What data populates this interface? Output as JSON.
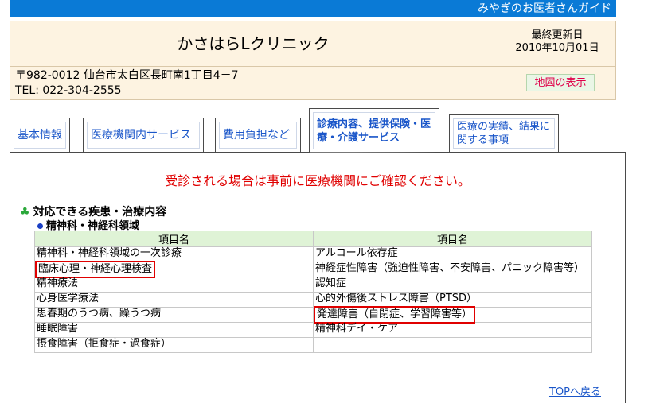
{
  "banner": "みやぎのお医者さんガイド",
  "clinic_name": "かさはらLクリニック",
  "updated": {
    "label": "最終更新日",
    "date": "2010年10月01日"
  },
  "address": {
    "line1": "〒982-0012 仙台市太白区長町南1丁目4－7",
    "line2": "TEL: 022-304-2555"
  },
  "map_button": "地図の表示",
  "tabs": [
    {
      "label": "基本情報"
    },
    {
      "label": "医療機関内サービス"
    },
    {
      "label": "費用負担など"
    },
    {
      "label": "診療内容、提供保険・医療・介護サービス"
    },
    {
      "label": "医療の実績、結果に関する事項"
    }
  ],
  "notice": "受診される場合は事前に医療機関にご確認ください。",
  "section_title": "対応できる疾患・治療内容",
  "subsection_title": "精神科・神経科領域",
  "table": {
    "headers": [
      "項目名",
      "項目名"
    ],
    "rows": [
      [
        "精神科・神経科領域の一次診療",
        "アルコール依存症"
      ],
      [
        "臨床心理・神経心理検査",
        "神経症性障害（強迫性障害、不安障害、パニック障害等）"
      ],
      [
        "精神療法",
        "認知症"
      ],
      [
        "心身医学療法",
        "心的外傷後ストレス障害（PTSD）"
      ],
      [
        "思春期のうつ病、躁うつ病",
        "発達障害（自閉症、学習障害等）"
      ],
      [
        "睡眠障害",
        "精神科デイ・ケア"
      ],
      [
        "摂食障害（拒食症・過食症）",
        ""
      ]
    ]
  },
  "top_link": "TOPへ戻る",
  "colors": {
    "banner": "#0a7ad6",
    "notice": "#e00000",
    "header_bg": "#fdf3e1",
    "table_header": "#dff3d6"
  }
}
